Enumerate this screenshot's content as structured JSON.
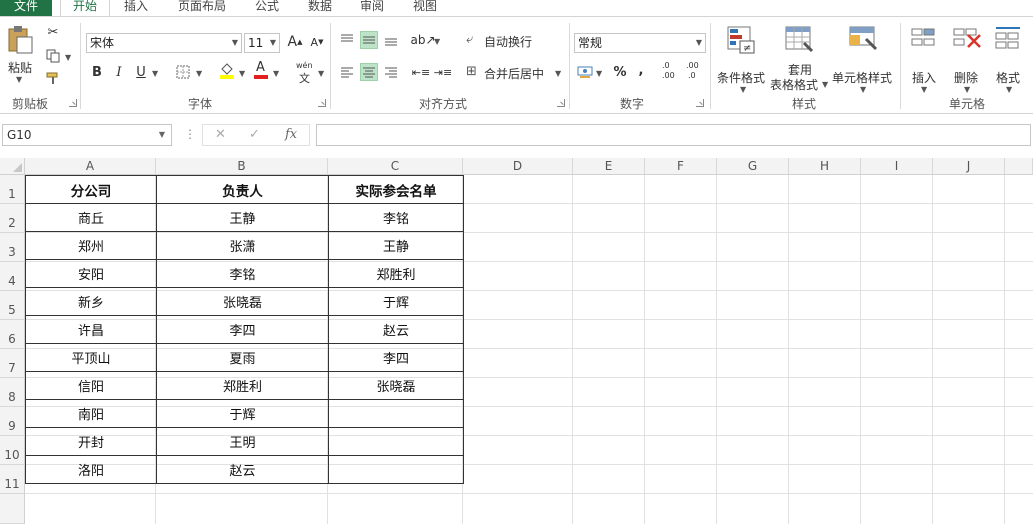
{
  "tabs": [
    "文件",
    "开始",
    "插入",
    "页面布局",
    "公式",
    "数据",
    "审阅",
    "视图"
  ],
  "ribbon": {
    "clipboard": {
      "paste": "粘贴",
      "group": "剪贴板"
    },
    "font": {
      "name": "宋体",
      "size": "11",
      "bold": "B",
      "italic": "I",
      "underline": "U",
      "font_color_glyph": "A",
      "phonetic_top": "wén",
      "phonetic_bottom": "文",
      "grow_glyph": "A",
      "shrink_glyph": "A",
      "group": "字体"
    },
    "alignment": {
      "wrap": "自动换行",
      "merge": "合并后居中",
      "group": "对齐方式"
    },
    "number": {
      "format": "常规",
      "percent": "%",
      "comma": ",",
      "inc_decimal": ".00",
      "dec_decimal": ".0",
      "group": "数字"
    },
    "styles": {
      "conditional": "条件格式",
      "table_top": "套用",
      "table_bottom": "表格格式",
      "cell": "单元格样式",
      "group": "样式"
    },
    "cells": {
      "insert": "插入",
      "delete": "删除",
      "format": "格式",
      "group": "单元格"
    }
  },
  "formula_bar": {
    "name_box": "G10",
    "fx": "fx",
    "cancel": "✕",
    "enter": "✓",
    "dots": "⋮"
  },
  "colors": {
    "accent": "#217346",
    "selected_button": "#bde3c9"
  },
  "sheet": {
    "columns": [
      "A",
      "B",
      "C",
      "D",
      "E",
      "F",
      "G",
      "H",
      "I",
      "J"
    ],
    "rows": [
      "1",
      "2",
      "3",
      "4",
      "5",
      "6",
      "7",
      "8",
      "9",
      "10",
      "11"
    ],
    "table": {
      "headers": [
        "分公司",
        "负责人",
        "实际参会名单"
      ],
      "rows": [
        [
          "商丘",
          "王静",
          "李铭"
        ],
        [
          "郑州",
          "张潇",
          "王静"
        ],
        [
          "安阳",
          "李铭",
          "郑胜利"
        ],
        [
          "新乡",
          "张晓磊",
          "于辉"
        ],
        [
          "许昌",
          "李四",
          "赵云"
        ],
        [
          "平顶山",
          "夏雨",
          "李四"
        ],
        [
          "信阳",
          "郑胜利",
          "张晓磊"
        ],
        [
          "南阳",
          "于辉",
          ""
        ],
        [
          "开封",
          "王明",
          ""
        ],
        [
          "洛阳",
          "赵云",
          ""
        ]
      ]
    }
  }
}
